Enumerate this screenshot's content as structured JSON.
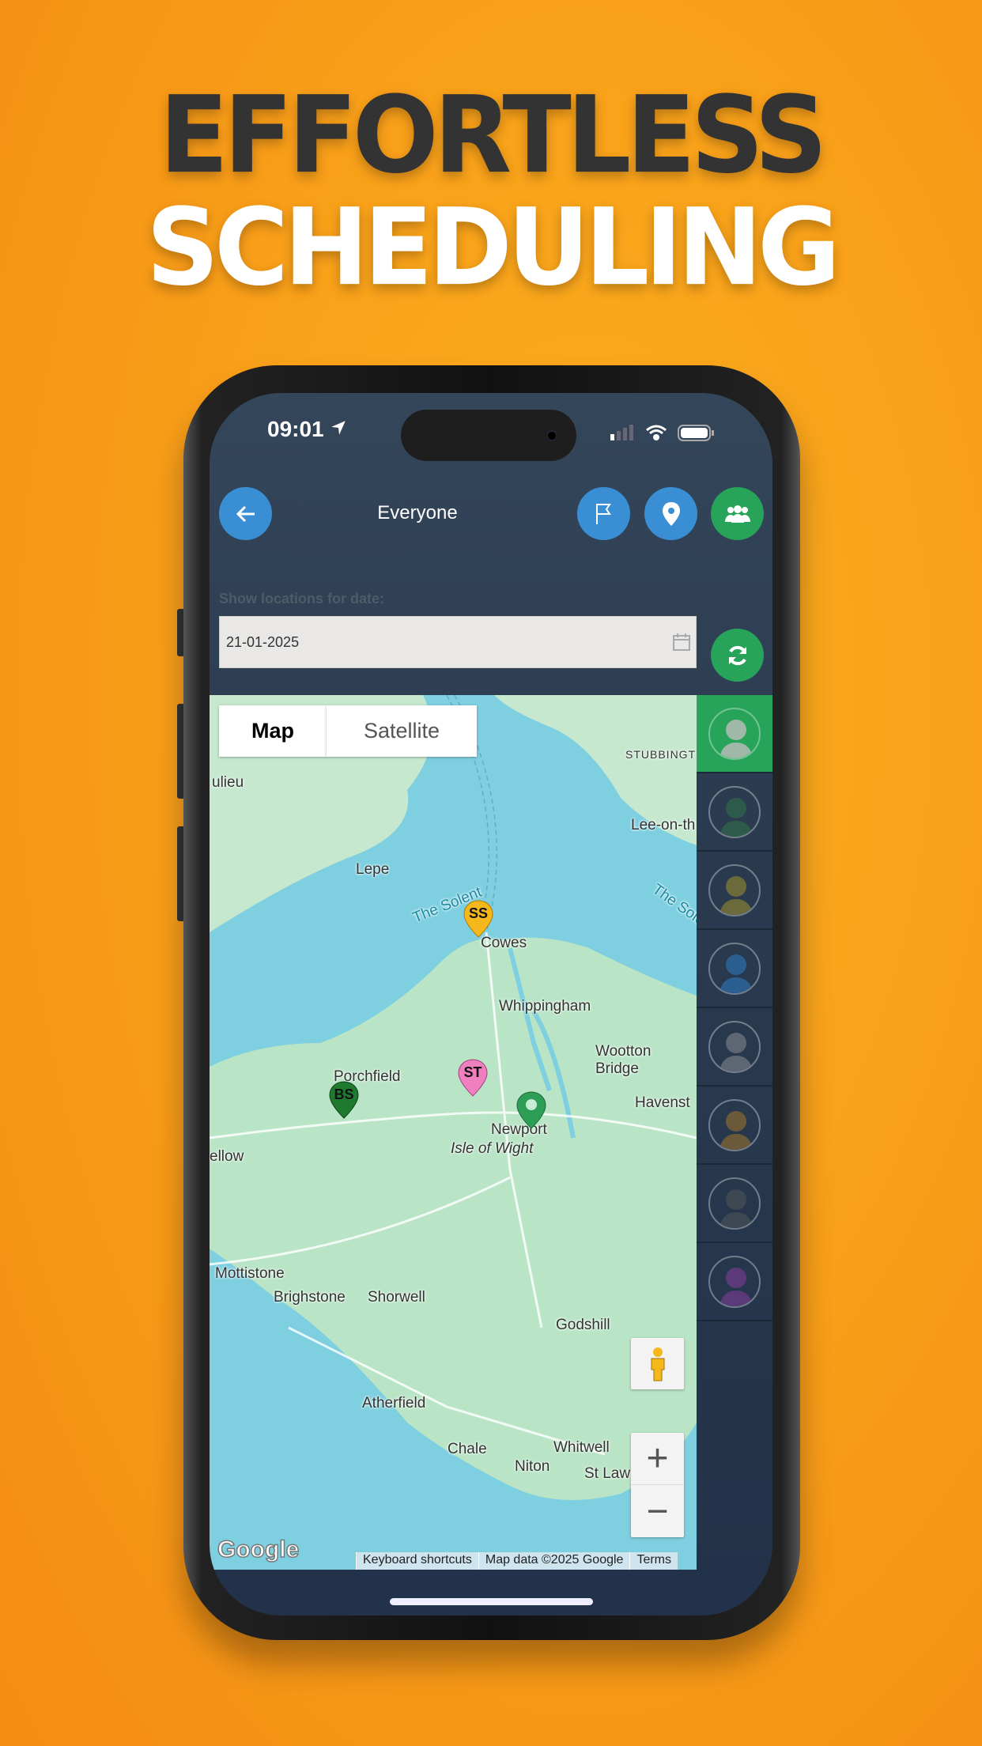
{
  "headline": {
    "line1": "EFFORTLESS",
    "line2": "SCHEDULING"
  },
  "status_bar": {
    "time": "09:01"
  },
  "header": {
    "title": "Everyone",
    "back": "arrow-left-icon",
    "buttons": [
      "flag-icon",
      "map-pin-icon",
      "group-icon"
    ]
  },
  "date_filter": {
    "label": "Show locations for date:",
    "value": "21-01-2025",
    "refresh": "refresh-icon"
  },
  "map": {
    "type_controls": [
      "Map",
      "Satellite"
    ],
    "selected_type": "Map",
    "labels": [
      "ulieu",
      "STUBBINGT",
      "Lee-on-th",
      "Lepe",
      "The Solent",
      "The Sole",
      "Cowes",
      "Whippingham",
      "Wootton",
      "Bridge",
      "Porchfield",
      "Havenst",
      "Newport",
      "Isle of Wight",
      "ellow",
      "Mottistone",
      "Brighstone",
      "Shorwell",
      "Godshill",
      "Atherfield",
      "Chale",
      "Whitwell",
      "Niton",
      "St Law"
    ],
    "markers": [
      {
        "initials": "SS",
        "color": "#f5b81c"
      },
      {
        "initials": "ST",
        "color": "#f07fc0"
      },
      {
        "initials": "BS",
        "color": "#1e7a2e"
      },
      {
        "initials": "",
        "color": "#2e9e57"
      }
    ],
    "logo": "Google",
    "attribution": [
      "Keyboard shortcuts",
      "Map data ©2025 Google",
      "Terms"
    ],
    "zoom_in": "+",
    "zoom_out": "−"
  },
  "people_sidebar": {
    "selected_index": 0,
    "selected_color": "#27a35a",
    "avatar_colors": [
      "#9fb8a8",
      "#2d5a4a",
      "#6b6a3a",
      "#2a5f90",
      "#5d6672",
      "#6a5a3a",
      "#3e4852",
      "#5a3a78"
    ]
  },
  "colors": {
    "water": "#7ecfe0",
    "land": "#b9e4c6",
    "app_bg": "#2c3d52",
    "accent_blue": "#3a8fd4",
    "accent_green": "#27a35a"
  }
}
